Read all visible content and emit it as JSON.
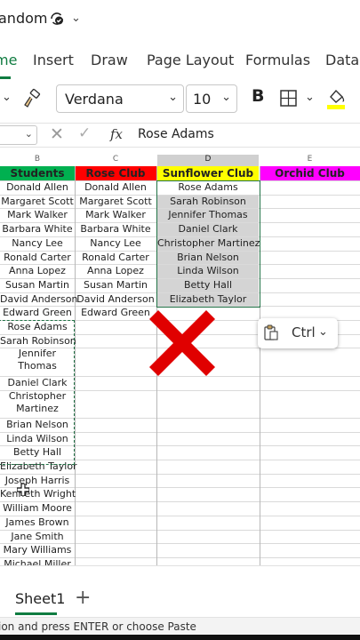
{
  "titlebar": {
    "title": "andom"
  },
  "tabs": [
    "me",
    "Insert",
    "Draw",
    "Page Layout",
    "Formulas",
    "Data"
  ],
  "toolbar": {
    "font": "Verdana",
    "size": "10",
    "bold": "B"
  },
  "formula_bar": {
    "fx": "fx",
    "value": "Rose Adams"
  },
  "columns": [
    "B",
    "C",
    "D",
    "E"
  ],
  "headers": {
    "students": {
      "label": "Students",
      "bg": "#00b050"
    },
    "rose": {
      "label": "Rose Club",
      "bg": "#ff0000"
    },
    "sunflower": {
      "label": "Sunflower Club",
      "bg": "#ffff00"
    },
    "orchid": {
      "label": "Orchid Club",
      "bg": "#ff00ff"
    }
  },
  "students": [
    "Donald Allen",
    "Margaret Scott",
    "Mark Walker",
    "Barbara White",
    "Nancy Lee",
    "Ronald Carter",
    "Anna Lopez",
    "Susan Martin",
    "David Anderson",
    "Edward Green",
    "Rose Adams",
    "Sarah Robinson",
    "Jennifer Thomas",
    "Daniel Clark",
    "Christopher Martinez",
    "Brian Nelson",
    "Linda Wilson",
    "Betty Hall",
    "Elizabeth Taylor",
    "Joseph Harris",
    "Kenneth Wright",
    "William Moore",
    "James Brown",
    "Jane Smith",
    "Mary Williams",
    "Michael Miller"
  ],
  "rose_club": [
    "Donald Allen",
    "Margaret Scott",
    "Mark Walker",
    "Barbara White",
    "Nancy Lee",
    "Ronald Carter",
    "Anna Lopez",
    "Susan Martin",
    "David Anderson",
    "Edward Green"
  ],
  "sunflower_club": [
    "Rose Adams",
    "Sarah Robinson",
    "Jennifer Thomas",
    "Daniel Clark",
    "Christopher Martinez",
    "Brian Nelson",
    "Linda Wilson",
    "Betty Hall",
    "Elizabeth Taylor"
  ],
  "paste_popup": {
    "label": "Ctrl"
  },
  "sheet_tab": "Sheet1",
  "add_sheet": "+",
  "status": "ion and press ENTER or choose Paste",
  "colors": {
    "accent": "#107c41",
    "selection": "#217346",
    "error_mark": "#e00000"
  }
}
